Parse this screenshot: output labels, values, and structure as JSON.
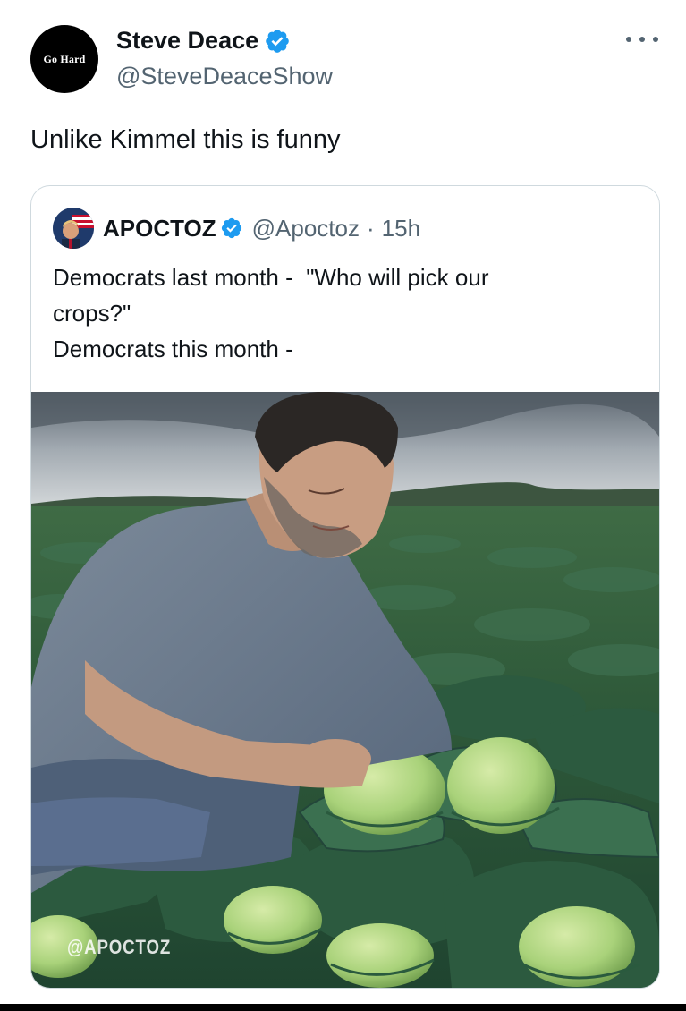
{
  "post": {
    "author": {
      "avatar_text": "Go Hard",
      "display_name": "Steve Deace",
      "handle": "@SteveDeaceShow",
      "verified_icon": "verified-badge-icon"
    },
    "more_icon": "more-options-icon",
    "text": "Unlike Kimmel this is funny"
  },
  "quoted_post": {
    "author": {
      "display_name": "APOCTOZ",
      "handle": "@Apoctoz",
      "separator": "·",
      "time": "15h",
      "verified_icon": "verified-badge-icon"
    },
    "text_lines": [
      "Democrats last month -  \"Who will pick our",
      "crops?\"",
      "Democrats this month -"
    ],
    "image": {
      "watermark": "@APOCTOZ",
      "icon": "photo-cabbage-field"
    }
  },
  "colors": {
    "text_primary": "#0f1419",
    "text_secondary": "#536471",
    "verified": "#1d9bf0",
    "border": "#cfd9de"
  }
}
